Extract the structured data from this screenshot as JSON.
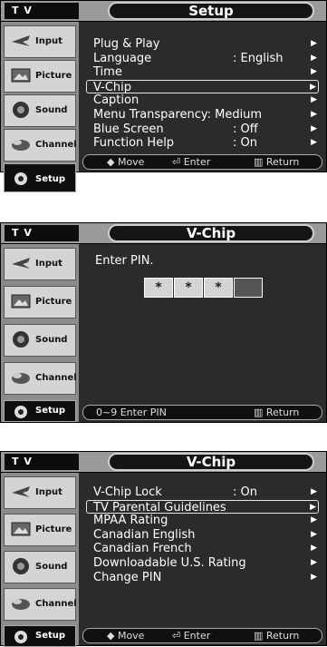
{
  "sidebar": [
    "Input",
    "Picture",
    "Sound",
    "Channel",
    "Setup"
  ],
  "screens": [
    {
      "tv": "T V",
      "title": "Setup",
      "rows": [
        {
          "label": "Plug & Play",
          "value": "",
          "arrow": true
        },
        {
          "label": "Language",
          "value": ": English",
          "arrow": true
        },
        {
          "label": "Time",
          "value": "",
          "arrow": true
        },
        {
          "label": "V-Chip",
          "value": "",
          "arrow": true,
          "hl": true
        },
        {
          "label": "Caption",
          "value": "",
          "arrow": true
        },
        {
          "label": "Menu Transparency: Medium",
          "value": "",
          "arrow": true
        },
        {
          "label": "Blue Screen",
          "value": ": Off",
          "arrow": true
        },
        {
          "label": "Function Help",
          "value": ": On",
          "arrow": true
        }
      ],
      "bottom": [
        "◆ Move",
        "⏎ Enter",
        "▥ Return"
      ]
    },
    {
      "tv": "T V",
      "title": "V-Chip",
      "pin_label": "Enter PIN.",
      "pin": [
        "*",
        "*",
        "*",
        ""
      ],
      "bottom": [
        "0~9 Enter PIN",
        "",
        "▥ Return"
      ]
    },
    {
      "tv": "T V",
      "title": "V-Chip",
      "rows": [
        {
          "label": "V-Chip Lock",
          "value": ": On",
          "arrow": true
        },
        {
          "label": "TV Parental Guidelines",
          "value": "",
          "arrow": true,
          "hl": true
        },
        {
          "label": "MPAA Rating",
          "value": "",
          "arrow": true
        },
        {
          "label": "Canadian English",
          "value": "",
          "arrow": true
        },
        {
          "label": "Canadian French",
          "value": "",
          "arrow": true
        },
        {
          "label": "Downloadable U.S. Rating",
          "value": "",
          "arrow": true
        },
        {
          "label": "Change PIN",
          "value": "",
          "arrow": true
        }
      ],
      "bottom": [
        "◆ Move",
        "⏎ Enter",
        "▥ Return"
      ]
    }
  ]
}
